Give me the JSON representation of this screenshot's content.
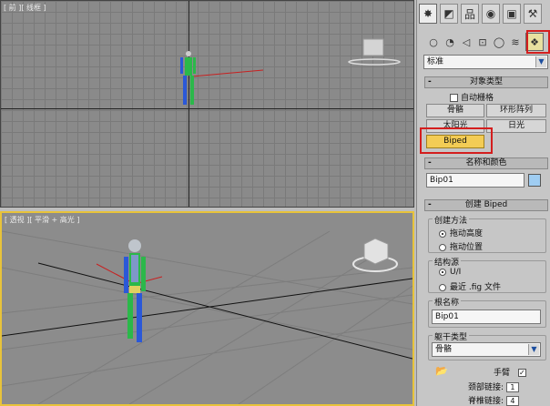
{
  "viewports": {
    "top_label": "[ 前 ][ 线框 ]",
    "persp_label": "[ 透视 ][ 平滑 + 高光 ]"
  },
  "tabs": [
    {
      "icon": "create-star-icon",
      "glyph": "✸"
    },
    {
      "icon": "modify-icon",
      "glyph": "◩"
    },
    {
      "icon": "hierarchy-icon",
      "glyph": "品"
    },
    {
      "icon": "motion-icon",
      "glyph": "◉"
    },
    {
      "icon": "display-icon",
      "glyph": "▣"
    },
    {
      "icon": "utilities-hammer-icon",
      "glyph": "⚒"
    }
  ],
  "categories": [
    {
      "icon": "geometry-icon",
      "glyph": "○"
    },
    {
      "icon": "shapes-icon",
      "glyph": "◔"
    },
    {
      "icon": "lights-icon",
      "glyph": "◁"
    },
    {
      "icon": "cameras-icon",
      "glyph": "⊡"
    },
    {
      "icon": "helpers-icon",
      "glyph": "◯"
    },
    {
      "icon": "spacewarps-icon",
      "glyph": "≋"
    },
    {
      "icon": "systems-icon",
      "glyph": "❖"
    }
  ],
  "dropdown": {
    "value": "标准"
  },
  "object_type": {
    "title": "对象类型",
    "autogrid": "自动栅格",
    "buttons": [
      "骨骼",
      "环形阵列",
      "太阳光",
      "日光",
      "Biped"
    ]
  },
  "name_color": {
    "title": "名称和颜色",
    "name": "Bip01"
  },
  "create_biped": {
    "title": "创建 Biped",
    "creation_method": "创建方法",
    "drag_height": "拖动高度",
    "drag_position": "拖动位置",
    "structure_source": "结构源",
    "ui": "U/I",
    "recent_fig": "最近 .fig 文件",
    "root_name_label": "根名称",
    "root_name": "Bip01",
    "body_type_label": "躯干类型",
    "body_type": "骨骼",
    "arms": "手臂",
    "neck_links": "颈部链接:",
    "neck_value": "1",
    "spine_links": "脊椎链接:",
    "spine_value": "4"
  },
  "colors": {
    "accent": "#f3cc55",
    "highlight": "#d41e1e",
    "viewport_border": "#e8c33a"
  }
}
